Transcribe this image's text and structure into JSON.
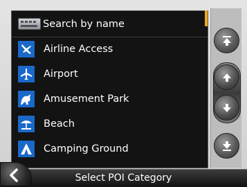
{
  "search": {
    "label": "Search by name",
    "icon": "keyboard-icon"
  },
  "categories": [
    {
      "label": "Airline Access",
      "icon": "airline-access-icon"
    },
    {
      "label": "Airport",
      "icon": "airplane-icon"
    },
    {
      "label": "Amusement Park",
      "icon": "amusement-park-icon"
    },
    {
      "label": "Beach",
      "icon": "beach-umbrella-icon"
    },
    {
      "label": "Camping Ground",
      "icon": "tent-icon"
    }
  ],
  "footer": {
    "title": "Select POI Category"
  },
  "colors": {
    "accent": "#f0a524",
    "icon_bg": "#1a69c9",
    "list_bg": "#131313"
  },
  "scroll": {
    "top_icon": "scroll-to-top-icon",
    "up_icon": "scroll-up-icon",
    "down_icon": "scroll-down-icon",
    "bottom_icon": "scroll-to-bottom-icon"
  },
  "back_icon": "back-chevron-icon"
}
